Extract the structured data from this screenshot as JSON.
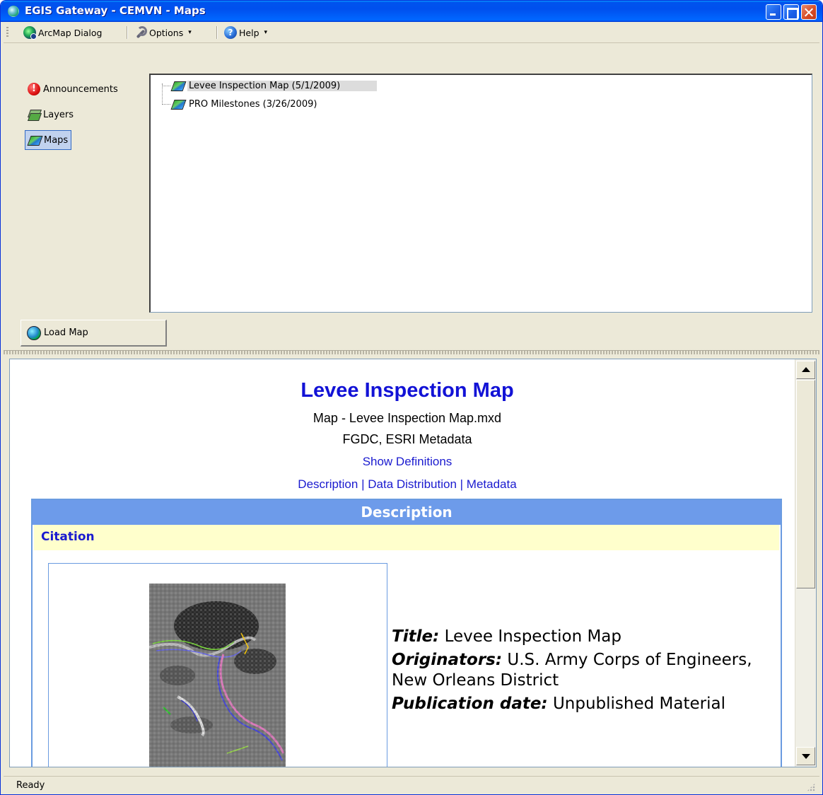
{
  "window": {
    "title": "EGIS Gateway - CEMVN - Maps"
  },
  "toolbar": {
    "arcmap_label": "ArcMap Dialog",
    "options_label": "Options",
    "help_label": "Help",
    "options_caret": "▾",
    "help_caret": "▾"
  },
  "nav": {
    "items": [
      {
        "label": "Announcements",
        "icon": "alert-icon"
      },
      {
        "label": "Layers",
        "icon": "layers-icon"
      },
      {
        "label": "Maps",
        "icon": "map-icon",
        "selected": true
      }
    ]
  },
  "tree": {
    "items": [
      {
        "label": "Levee Inspection Map (5/1/2009)",
        "selected": true
      },
      {
        "label": "PRO Milestones (3/26/2009)"
      }
    ]
  },
  "load_button": {
    "label": "Load Map"
  },
  "viewer": {
    "title": "Levee Inspection Map",
    "file_line": "Map - Levee Inspection Map.mxd",
    "meta_line": "FGDC, ESRI Metadata",
    "show_definitions": "Show Definitions",
    "links": {
      "description": "Description",
      "data_distribution": "Data Distribution",
      "metadata": "Metadata",
      "separator": "|"
    },
    "section_header": "Description",
    "citation_label": "Citation",
    "fields": {
      "title_key": "Title:",
      "title_val": "Levee Inspection Map",
      "originators_key": "Originators:",
      "originators_val": "U.S. Army Corps of Engineers, New Orleans District",
      "pubdate_key": "Publication date:",
      "pubdate_val": "Unpublished Material"
    }
  },
  "status": {
    "text": "Ready"
  },
  "colors": {
    "link": "#1a1acf",
    "title_blue": "#1212d6",
    "section_header_bg": "#6d9bea",
    "citation_bg": "#ffffcc"
  }
}
